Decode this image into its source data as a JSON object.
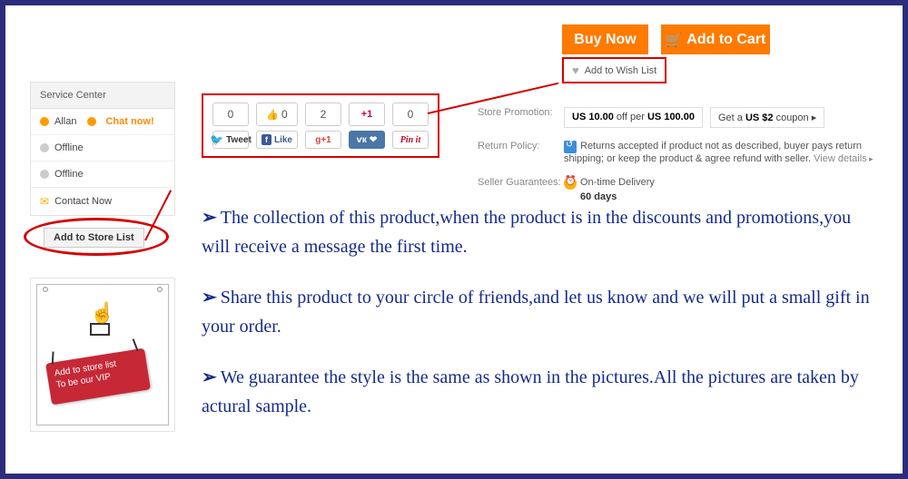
{
  "actions": {
    "buy_now": "Buy Now",
    "add_to_cart": "Add to Cart",
    "wishlist": "Add to Wish List"
  },
  "info": {
    "promotion_label": "Store Promotion:",
    "promo1_prefix": "US 10.00",
    "promo1_mid": " off per ",
    "promo1_suffix": "US 100.00",
    "promo2_prefix": "Get a ",
    "promo2_bold": "US $2",
    "promo2_suffix": " coupon",
    "return_label": "Return Policy:",
    "return_text": "Returns accepted if product not as described, buyer pays return shipping; or keep the product & agree refund with seller. ",
    "return_view": "View details",
    "guarantee_label": "Seller Guarantees:",
    "guarantee_line": "On-time Delivery",
    "guarantee_days": "60 days"
  },
  "service": {
    "header": "Service Center",
    "allan": "Allan",
    "chat_now": "Chat now!",
    "offline": "Offline",
    "contact": "Contact Now"
  },
  "addstore": "Add to Store List",
  "vip": {
    "line1": "Add to store list",
    "line2": "To be our VIP"
  },
  "share": {
    "c_tweet": "0",
    "c_like": "0",
    "c_gplus": "2",
    "c_plus1": "+1",
    "c_pin": "0",
    "tweet": "Tweet",
    "like": "Like",
    "gplus": "g+1",
    "vk": "❤",
    "pin": "Pin it"
  },
  "bullets": {
    "b1": "The collection of this product,when the product is in the discounts and promotions,you will receive a message the first time.",
    "b2": "Share this product to your circle of friends,and let us know and we will put a small gift in your order.",
    "b3": "We guarantee the style is the same as shown in the pictures.All the pictures are taken by actural sample."
  }
}
